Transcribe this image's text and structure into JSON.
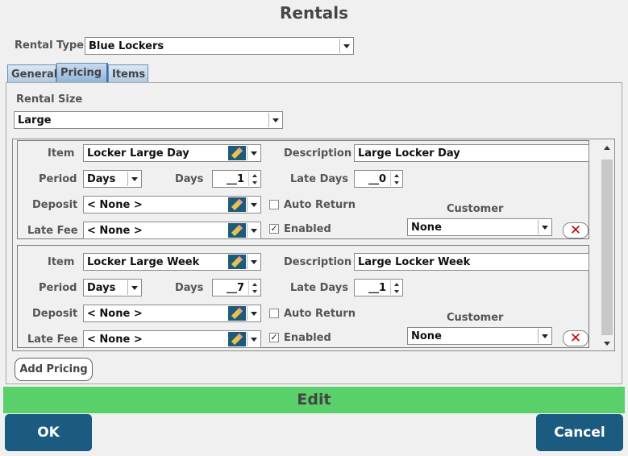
{
  "window": {
    "title": "Rentals"
  },
  "rental_type": {
    "label": "Rental Type",
    "value": "Blue Lockers"
  },
  "tabs": [
    {
      "label": "General",
      "active": false
    },
    {
      "label": "Pricing",
      "active": true
    },
    {
      "label": "Items",
      "active": false
    }
  ],
  "rental_size": {
    "label": "Rental Size",
    "value": "Large"
  },
  "field_labels": {
    "item": "Item",
    "description": "Description",
    "period": "Period",
    "days": "Days",
    "late_days": "Late Days",
    "deposit": "Deposit",
    "auto_return": "Auto Return",
    "customer": "Customer",
    "late_fee": "Late Fee",
    "enabled": "Enabled"
  },
  "pricing": [
    {
      "item": "Locker Large Day",
      "description": "Large Locker Day",
      "period": "Days",
      "days": "__1",
      "late_days": "__0",
      "deposit": "< None >",
      "late_fee": "< None >",
      "auto_return": false,
      "enabled": true,
      "customer": "None"
    },
    {
      "item": "Locker Large Week",
      "description": "Large Locker Week",
      "period": "Days",
      "days": "__7",
      "late_days": "__1",
      "deposit": "< None >",
      "late_fee": "< None >",
      "auto_return": false,
      "enabled": true,
      "customer": "None"
    }
  ],
  "buttons": {
    "add_pricing": "Add Pricing",
    "edit": "Edit",
    "ok": "OK",
    "cancel": "Cancel"
  },
  "colors": {
    "edit_bar": "#5ad06a",
    "primary_button": "#1c5b80",
    "delete_icon": "#cc0000"
  }
}
